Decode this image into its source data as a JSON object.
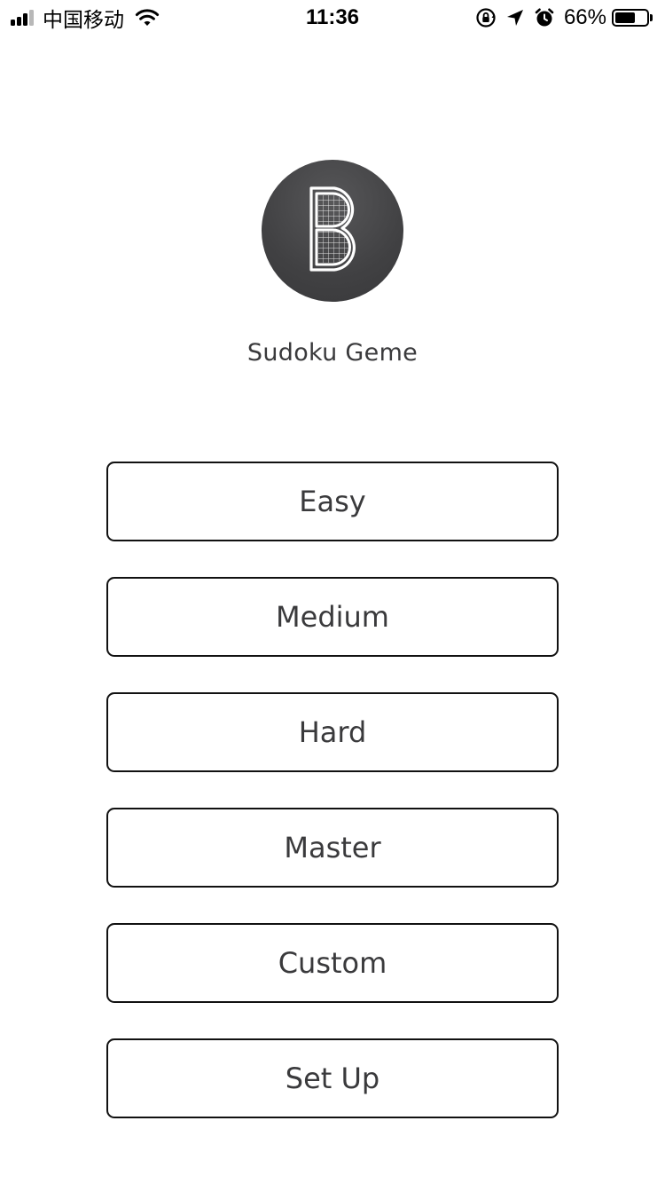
{
  "status_bar": {
    "carrier": "中国移动",
    "time": "11:36",
    "battery_percent": "66%",
    "battery_level": 0.66,
    "icons": [
      "signal-icon",
      "wifi-icon",
      "orientation-lock-icon",
      "location-arrow-icon",
      "alarm-icon",
      "battery-icon"
    ]
  },
  "app": {
    "title": "Sudoku Geme",
    "logo_icon": "sudoku-b-logo-icon",
    "logo_bg_color": "#414143"
  },
  "menu": {
    "easy_label": "Easy",
    "medium_label": "Medium",
    "hard_label": "Hard",
    "master_label": "Master",
    "custom_label": "Custom",
    "setup_label": "Set Up"
  }
}
